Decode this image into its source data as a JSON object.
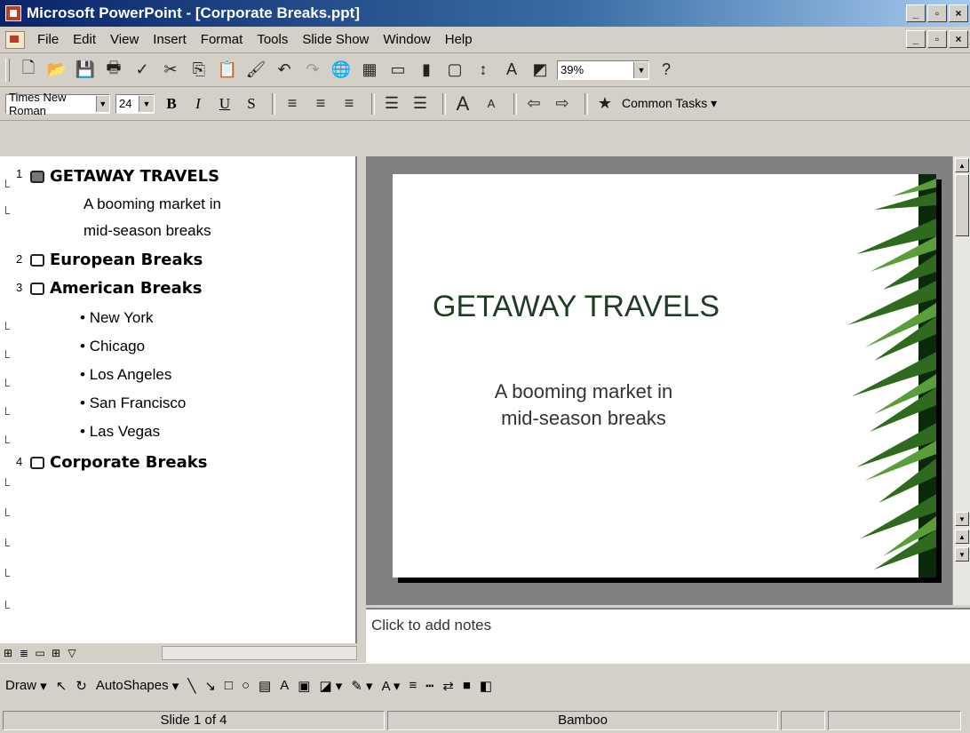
{
  "window": {
    "title": "Microsoft PowerPoint - [Corporate Breaks.ppt]"
  },
  "menu": {
    "items": [
      "File",
      "Edit",
      "View",
      "Insert",
      "Format",
      "Tools",
      "Slide Show",
      "Window",
      "Help"
    ]
  },
  "standard_toolbar": {
    "zoom": "39%"
  },
  "format_toolbar": {
    "font": "Times New Roman",
    "size": "24",
    "bold": "B",
    "italic": "I",
    "underline": "U",
    "shadow": "S",
    "common_tasks": "Common Tasks"
  },
  "outline": {
    "slide1_title": "GETAWAY TRAVELS",
    "slide1_sub1": "A booming market in",
    "slide1_sub2": "mid-season breaks",
    "slide2_title": "European Breaks",
    "slide3_title": "American Breaks",
    "bullets": [
      "New York",
      "Chicago",
      "Los Angeles",
      "San Francisco",
      "Las Vegas"
    ],
    "slide4_title": "Corporate Breaks",
    "numbers": [
      "1",
      "2",
      "3",
      "4"
    ]
  },
  "slide": {
    "title": "GETAWAY TRAVELS",
    "sub1": "A booming market in",
    "sub2": "mid-season breaks"
  },
  "notes": {
    "placeholder": "Click to add notes"
  },
  "drawing_toolbar": {
    "draw": "Draw",
    "autoshapes": "AutoShapes"
  },
  "status": {
    "slide": "Slide 1 of 4",
    "design": "Bamboo"
  }
}
